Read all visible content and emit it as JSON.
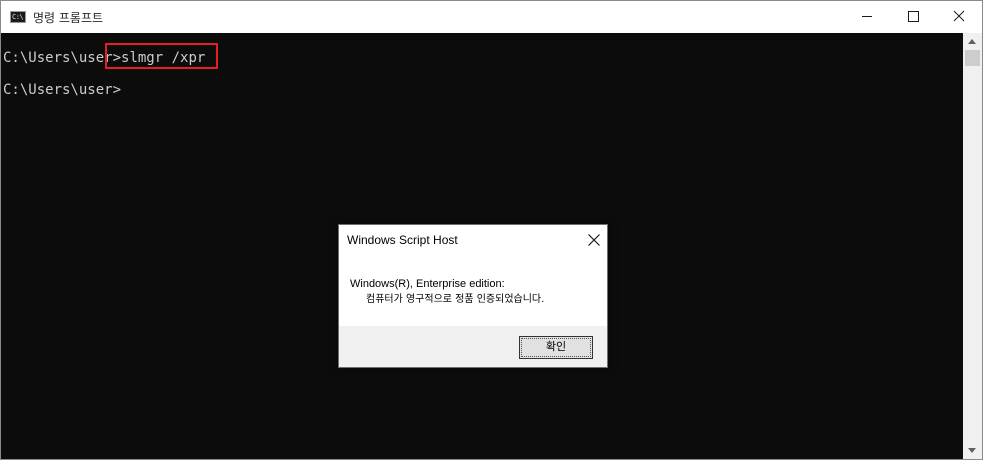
{
  "window": {
    "title": "명령 프롬프트",
    "icon_label": "C:\\"
  },
  "console": {
    "line1_prompt": "C:\\Users\\user>",
    "line1_command": "slmgr /xpr",
    "line2_prompt": "C:\\Users\\user>"
  },
  "dialog": {
    "title": "Windows Script Host",
    "message_line1": "Windows(R), Enterprise edition:",
    "message_line2": "컴퓨터가 영구적으로 정품 인증되었습니다.",
    "ok_label": "확인"
  },
  "colors": {
    "console_bg": "#0c0c0c",
    "console_text": "#cccccc",
    "highlight": "#e31e24"
  }
}
